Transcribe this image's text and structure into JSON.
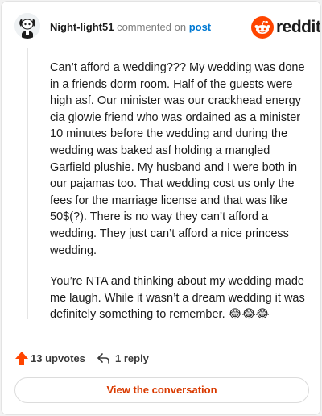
{
  "comment": {
    "username": "Night-light51",
    "action_text": "commented on",
    "post_link": "post",
    "paragraphs": [
      "Can’t afford a wedding??? My wedding was done in a friends dorm room. Half of the guests were high asf. Our minister was our crackhead energy cia glowie friend who was ordained as a minister 10 minutes before the wedding and during the wedding was baked asf holding a mangled Garfield plushie. My husband and I were both in our pajamas too. That wedding cost us only the fees for the marriage license and that was like 50$(?). There is no way they can’t afford a wedding. They just can’t afford a nice princess wedding.",
      "You’re NTA and thinking about my wedding made me laugh. While it wasn’t a dream wedding it was definitely something to remember. 😂😂😂"
    ]
  },
  "brand": {
    "wordmark": "reddit",
    "icon": "reddit-snoo-icon",
    "color": "#ff4500"
  },
  "stats": {
    "upvotes": "13 upvotes",
    "replies": "1 reply",
    "upvote_icon": "upvote-arrow-icon",
    "reply_icon": "reply-arrow-icon"
  },
  "cta": {
    "label": "View the conversation",
    "color": "#d93a00"
  },
  "colors": {
    "username": "#1c1c1c",
    "link": "#0079d3",
    "upvote": "#ff4500"
  }
}
